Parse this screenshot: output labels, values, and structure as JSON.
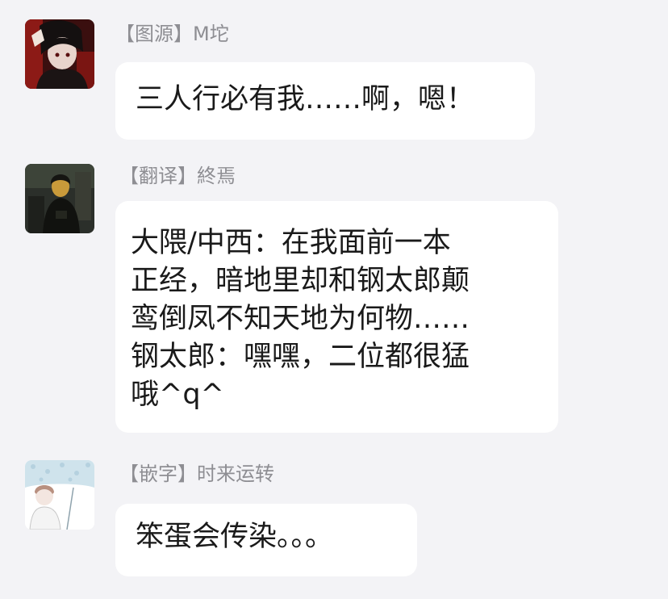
{
  "messages": [
    {
      "sender": "【图源】M坨",
      "text": "三人行必有我……啊，嗯！",
      "avatar_icon": "dark-haired-character-avatar-icon"
    },
    {
      "sender": "【翻译】終焉",
      "text": "大隈/中西：在我面前一本\n正经，暗地里却和钢太郎颠\n鸾倒凤不知天地为何物……\n钢太郎：嘿嘿，二位都很猛\n哦^q^",
      "avatar_icon": "person-in-dark-room-avatar-icon"
    },
    {
      "sender": "【嵌字】时来运转",
      "text": "笨蛋会传染。。。",
      "avatar_icon": "umbrella-illustration-avatar-icon"
    }
  ],
  "colors": {
    "background": "#f3f3f6",
    "bubble": "#ffffff",
    "sender_text": "#8e8e93",
    "message_text": "#1a1a1a"
  }
}
